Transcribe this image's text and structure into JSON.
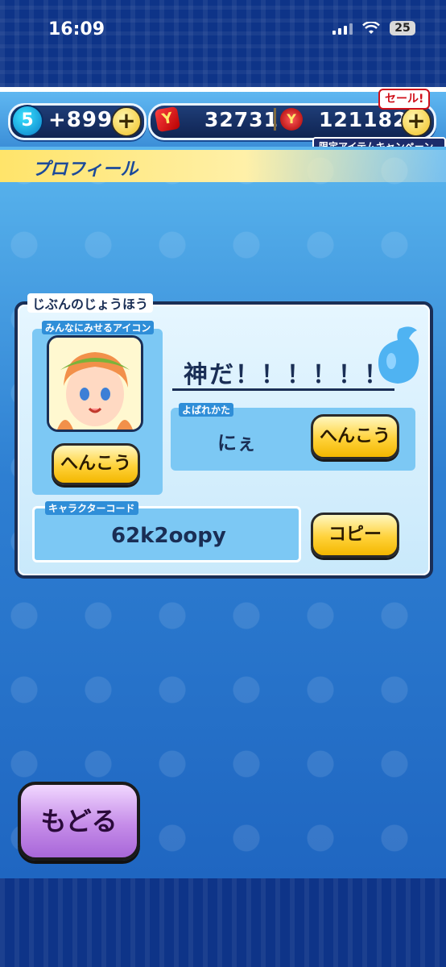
{
  "status_bar": {
    "time": "16:09",
    "battery": "25"
  },
  "header": {
    "level": "5",
    "stamina": "+899",
    "currency1": "32731",
    "currency2": "121182",
    "sale_label": "セール!",
    "campaign_label": "限定アイテムキャンペーン中!"
  },
  "page_title": "プロフィール",
  "profile": {
    "section_label": "じぶんのじょうほう",
    "icon_label": "みんなにみせるアイコン",
    "icon_change_button": "へんこう",
    "name": "神だ！！！！！！",
    "nickname_label": "よばれかた",
    "nickname_value": "にぇ",
    "nickname_change_button": "へんこう",
    "character_code_label": "キャラクターコード",
    "character_code": "62k2oopy",
    "copy_button": "コピー"
  },
  "back_button": "もどる"
}
